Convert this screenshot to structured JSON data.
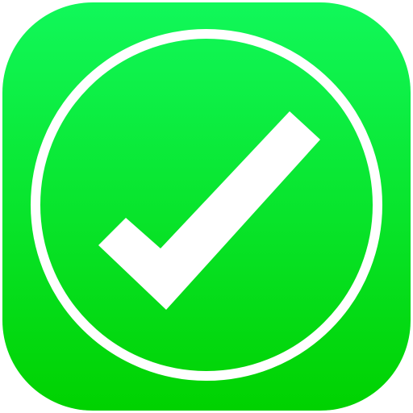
{
  "app_icon": {
    "icon": "checkmark-in-circle-icon",
    "colors": {
      "gradient_top": "#11f85a",
      "gradient_bottom": "#00d200",
      "symbol": "#ffffff"
    }
  }
}
